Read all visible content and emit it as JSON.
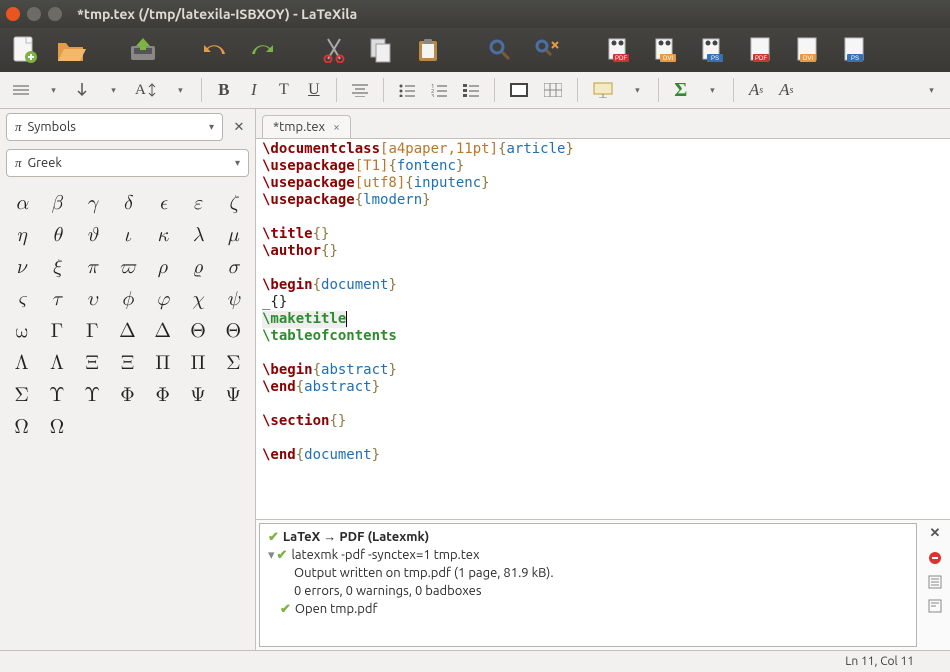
{
  "window": {
    "title": "*tmp.tex (/tmp/latexila-ISBXOY) - LaTeXila"
  },
  "sidebar": {
    "panel_label": "Symbols",
    "category_label": "Greek",
    "symbols": [
      [
        "α",
        "β",
        "γ",
        "δ",
        "ϵ",
        "ε",
        "ζ"
      ],
      [
        "η",
        "θ",
        "ϑ",
        "ι",
        "κ",
        "λ",
        "μ"
      ],
      [
        "ν",
        "ξ",
        "π",
        "ϖ",
        "ρ",
        "ϱ",
        "σ"
      ],
      [
        "ς",
        "τ",
        "υ",
        "ϕ",
        "φ",
        "χ",
        "ψ"
      ],
      [
        "ω",
        "Γ",
        "Γ",
        "Δ",
        "Δ",
        "Θ",
        "Θ"
      ],
      [
        "Λ",
        "Λ",
        "Ξ",
        "Ξ",
        "Π",
        "Π",
        "Σ"
      ],
      [
        "Σ",
        "Υ",
        "Υ",
        "Φ",
        "Φ",
        "Ψ",
        "Ψ"
      ],
      [
        "Ω",
        "Ω",
        "",
        "",
        "",
        "",
        ""
      ]
    ]
  },
  "tab": {
    "label": "*tmp.tex"
  },
  "code": {
    "l1a": "\\documentclass",
    "l1b": "[a4paper,11pt]",
    "l1c": "article",
    "l2a": "\\usepackage",
    "l2b": "[T1]",
    "l2c": "fontenc",
    "l3a": "\\usepackage",
    "l3b": "[utf8]",
    "l3c": "inputenc",
    "l4a": "\\usepackage",
    "l4c": "lmodern",
    "l6a": "\\title",
    "l7a": "\\author",
    "l9a": "\\begin",
    "l9c": "document",
    "l10": "_{}",
    "l11a": "\\maketitle",
    "l12a": "\\tableofcontents",
    "l14a": "\\begin",
    "l14c": "abstract",
    "l15a": "\\end",
    "l15c": "abstract",
    "l17a": "\\section",
    "l19a": "\\end",
    "l19c": "document"
  },
  "build": {
    "title": "LaTeX → PDF (Latexmk)",
    "cmd": "latexmk -pdf -synctex=1 tmp.tex",
    "out": "Output written on tmp.pdf (1 page, 81.9 kB).",
    "stats": "0 errors, 0 warnings, 0 badboxes",
    "open": "Open tmp.pdf"
  },
  "status": {
    "pos": "Ln 11, Col 11"
  },
  "math": {
    "As_sup": "Aˢ",
    "As_sub": "Aₛ"
  }
}
